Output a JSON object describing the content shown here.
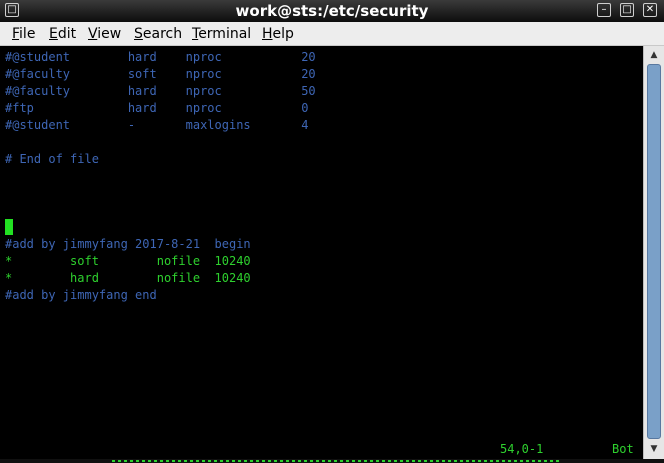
{
  "window": {
    "title": "work@sts:/etc/security",
    "controls": {
      "menu": "□",
      "minimize": "–",
      "maximize": "□",
      "close": "✕"
    }
  },
  "menubar": {
    "items": [
      "File",
      "Edit",
      "View",
      "Search",
      "Terminal",
      "Help"
    ]
  },
  "terminal": {
    "lines": [
      "#@student        hard    nproc           20",
      "#@faculty        soft    nproc           20",
      "#@faculty        hard    nproc           50",
      "#ftp             hard    nproc           0",
      "#@student        -       maxlogins       4",
      "",
      "# End of file",
      "",
      "",
      "",
      "",
      "#add by jimmyfang 2017-8-21  begin",
      "*        soft        nofile  10240",
      "*        hard        nofile  10240",
      "#add by jimmyfang end"
    ],
    "line_colors": [
      "blue",
      "blue",
      "blue",
      "blue",
      "blue",
      "blue",
      "blue",
      "blue",
      "blue",
      "blue",
      "blue",
      "blue",
      "green",
      "green",
      "blue"
    ],
    "status_position": "54,0-1",
    "status_scroll": "Bot"
  },
  "scrollbar": {
    "thumb_start_fraction": 0.0,
    "thumb_end_fraction": 1.0
  },
  "colors": {
    "comment_blue": "#3e66b5",
    "text_green": "#2ed12e",
    "cursor_green": "#22e022",
    "background": "#000000"
  }
}
